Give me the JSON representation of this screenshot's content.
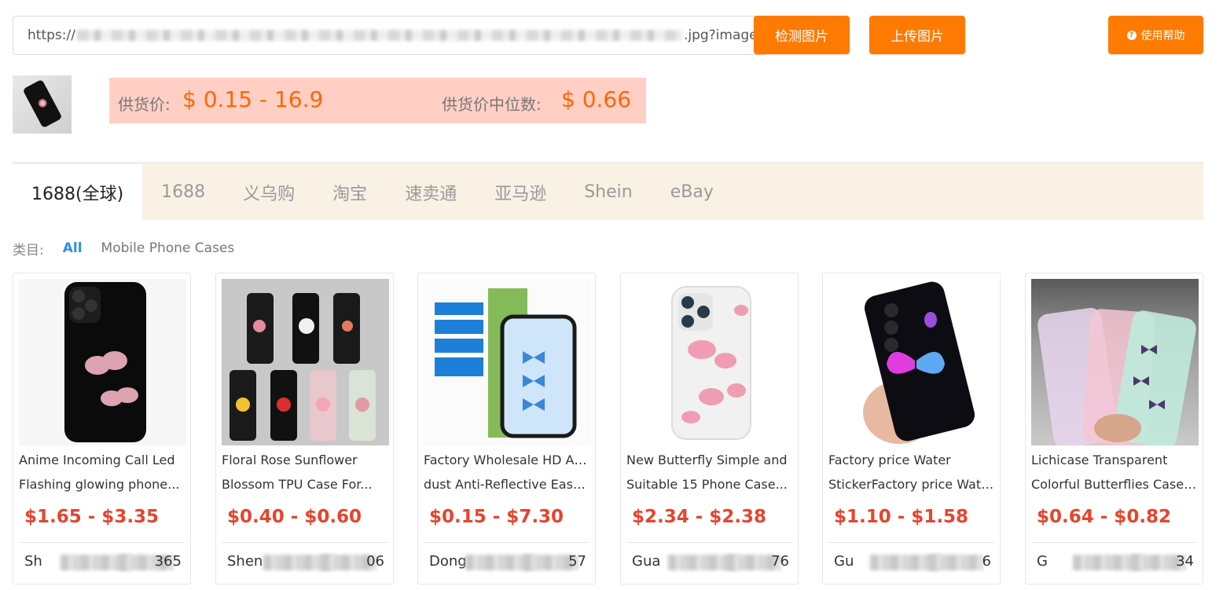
{
  "search": {
    "url_prefix": "https://",
    "url_suffix": ".jpg?imageV"
  },
  "buttons": {
    "detect": "检测图片",
    "upload": "上传图片",
    "help": "使用帮助"
  },
  "price_summary": {
    "supply_label": "供货价:",
    "supply_value": "$ 0.15 - 16.9",
    "median_label": "供货价中位数:",
    "median_value": "$ 0.66"
  },
  "tabs": [
    "1688(全球)",
    "1688",
    "义乌购",
    "淘宝",
    "速卖通",
    "亚马逊",
    "Shein",
    "eBay"
  ],
  "categories": {
    "label": "类目:",
    "all": "All",
    "items": [
      "Mobile Phone Cases"
    ]
  },
  "products": [
    {
      "title_line1": "Anime Incoming Call Led",
      "title_line2": "Flashing glowing phone...",
      "price": "$1.65 - $3.35",
      "seller_start": "Sh",
      "seller_end": "365"
    },
    {
      "title_line1": "Floral Rose Sunflower",
      "title_line2": "Blossom TPU Case For...",
      "price": "$0.40 - $0.60",
      "seller_start": "Shen",
      "seller_end": "06"
    },
    {
      "title_line1": "Factory Wholesale HD Anti-",
      "title_line2": "dust Anti-Reflective Easy fi...",
      "price": "$0.15 - $7.30",
      "seller_start": "Dong",
      "seller_end": "57"
    },
    {
      "title_line1": "New Butterfly Simple and",
      "title_line2": "Suitable 15 Phone Case...",
      "price": "$2.34 - $2.38",
      "seller_start": "Gua",
      "seller_end": "76"
    },
    {
      "title_line1": "Factory price Water",
      "title_line2": "StickerFactory price Water...",
      "price": "$1.10 - $1.58",
      "seller_start": "Gu",
      "seller_end": "6"
    },
    {
      "title_line1": "Lichicase Transparent",
      "title_line2": "Colorful Butterflies Case F...",
      "price": "$0.64 - $0.82",
      "seller_start": "G",
      "seller_end": "34"
    }
  ],
  "colors": {
    "accent": "#ff7a00",
    "price_red": "#e8432c",
    "price_box_bg": "#ffcfc5",
    "tab_bar_bg": "#f8f1e4",
    "category_active": "#2f8fe0"
  },
  "icons": {
    "help": "question-circle-icon"
  }
}
